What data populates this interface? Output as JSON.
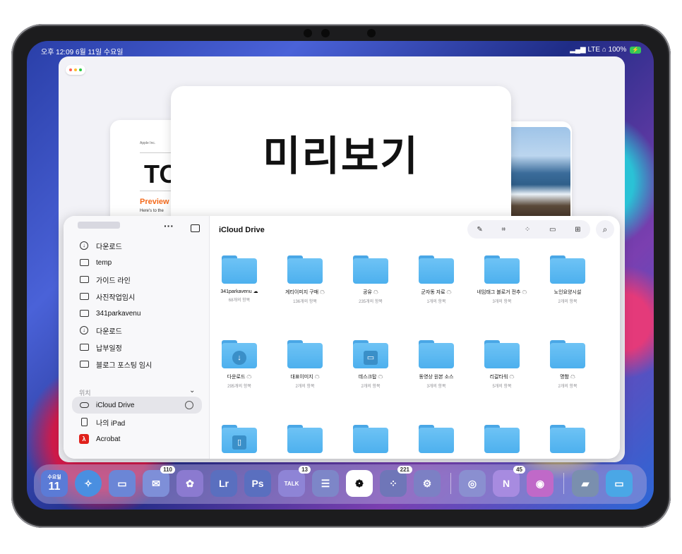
{
  "status": {
    "time_date": "오후 12:09  6월 11일 수요일",
    "right": "LTE ⌂ 100%"
  },
  "background_window": {
    "center_title": "미리보기",
    "left_card": {
      "company": "Apple Inc.",
      "heading": "TO",
      "preview": "Preview",
      "body": "Here's to the"
    }
  },
  "sidebar": {
    "items": [
      {
        "label": "다운로드",
        "icon": "download-icon"
      },
      {
        "label": "temp",
        "icon": "folder-icon"
      },
      {
        "label": "가이드 라인",
        "icon": "folder-icon"
      },
      {
        "label": "사진작업임시",
        "icon": "folder-icon"
      },
      {
        "label": "341parkavenu",
        "icon": "folder-icon"
      },
      {
        "label": "다운로드",
        "icon": "download-icon"
      },
      {
        "label": "납부일정",
        "icon": "folder-icon"
      },
      {
        "label": "블로그 포스팅 임시",
        "icon": "folder-icon"
      }
    ],
    "section_label": "위치",
    "locations": [
      {
        "label": "iCloud Drive",
        "icon": "cloud-icon"
      },
      {
        "label": "나의 iPad",
        "icon": "ipad-icon"
      },
      {
        "label": "Acrobat",
        "icon": "acrobat-icon"
      }
    ]
  },
  "main": {
    "title": "iCloud Drive",
    "folders": [
      {
        "name": "341parkavenu ☁",
        "count": "68개의 항목"
      },
      {
        "name": "게티이미지 구매 ☁",
        "count": "136개의 항목"
      },
      {
        "name": "공유 ☁",
        "count": "235개의 항목"
      },
      {
        "name": "군자동 자료 ☁",
        "count": "1개의 항목"
      },
      {
        "name": "네임태그 블로거 전추 ☁",
        "count": "3개의 항목"
      },
      {
        "name": "노인요양시설",
        "count": "2개의 항목"
      },
      {
        "name": "다운로드 ☁",
        "count": "295개의 항목"
      },
      {
        "name": "대표이미지 ☁",
        "count": "2개의 항목"
      },
      {
        "name": "데스크탑 ☁",
        "count": "2개의 항목"
      },
      {
        "name": "동영상 원본 소스",
        "count": "3개의 항목"
      },
      {
        "name": "리갈타워 ☁",
        "count": "5개의 항목"
      },
      {
        "name": "명함 ☁",
        "count": "2개의 항목"
      }
    ]
  },
  "dock": {
    "calendar_day": "수요일",
    "calendar_date": "11",
    "mail_badge": "110",
    "talk_badge": "13",
    "apps_badge": "221",
    "notion_badge": "45",
    "lr": "Lr",
    "ps": "Ps",
    "talk": "TALK",
    "notion": "N"
  }
}
